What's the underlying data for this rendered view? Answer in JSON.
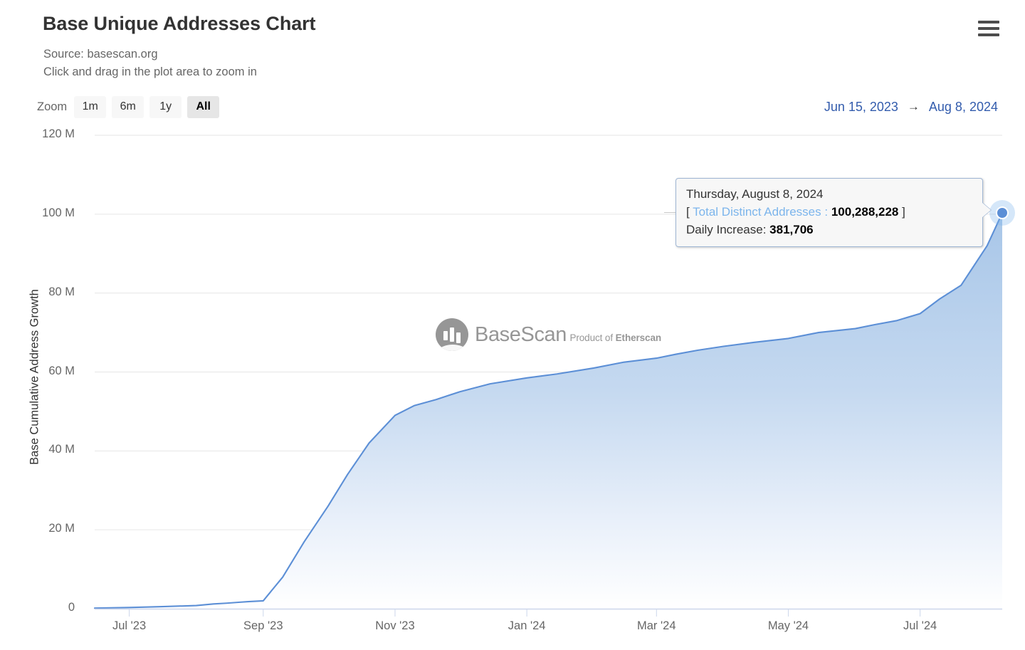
{
  "header": {
    "title": "Base Unique Addresses Chart",
    "source_line": "Source: basescan.org",
    "hint_line": "Click and drag in the plot area to zoom in",
    "menu_icon": "hamburger-menu-icon"
  },
  "range_selector": {
    "zoom_label": "Zoom",
    "buttons": [
      {
        "label": "1m",
        "selected": false
      },
      {
        "label": "6m",
        "selected": false
      },
      {
        "label": "1y",
        "selected": false
      },
      {
        "label": "All",
        "selected": true
      }
    ],
    "date_from": "Jun 15, 2023",
    "date_arrow": "→",
    "date_to": "Aug 8, 2024",
    "link_color": "#335cad"
  },
  "tooltip": {
    "date": "Thursday, August 8, 2024",
    "open_bracket": "[",
    "series_name": "Total Distinct Addresses",
    "colon": ":",
    "series_value": "100,288,228",
    "close_bracket": "]",
    "secondary_label": "Daily Increase:",
    "secondary_value": "381,706",
    "series_color": "#7cb5ec"
  },
  "watermark": {
    "main": "BaseScan",
    "sub_prefix": "Product of ",
    "sub_bold": "Etherscan"
  },
  "chart_data": {
    "type": "area",
    "title": "Base Unique Addresses Chart",
    "subtitle": "Source: basescan.org",
    "xlabel": "",
    "ylabel": "Base Cumulative Address Growth",
    "ylim": [
      0,
      120000000
    ],
    "y_ticks": [
      0,
      20000000,
      40000000,
      60000000,
      80000000,
      100000000,
      120000000
    ],
    "y_tick_labels": [
      "0",
      "20 M",
      "40 M",
      "60 M",
      "80 M",
      "100 M",
      "120 M"
    ],
    "x_tick_labels": [
      "Jul '23",
      "Sep '23",
      "Nov '23",
      "Jan '24",
      "Mar '24",
      "May '24",
      "Jul '24"
    ],
    "x_range": [
      "Jun 15, 2023",
      "Aug 8, 2024"
    ],
    "grid": true,
    "legend_position": "none",
    "line_color": "#5c8fd6",
    "fill_top_color": "#a8c6e8",
    "fill_bottom_color": "#ffffff",
    "series": [
      {
        "name": "Total Distinct Addresses",
        "x": [
          "2023-06-15",
          "2023-07-01",
          "2023-07-15",
          "2023-08-01",
          "2023-08-09",
          "2023-08-15",
          "2023-08-20",
          "2023-08-25",
          "2023-09-01",
          "2023-09-10",
          "2023-09-20",
          "2023-10-01",
          "2023-10-10",
          "2023-10-20",
          "2023-11-01",
          "2023-11-10",
          "2023-11-20",
          "2023-12-01",
          "2023-12-15",
          "2024-01-01",
          "2024-01-15",
          "2024-02-01",
          "2024-02-15",
          "2024-03-01",
          "2024-03-10",
          "2024-03-20",
          "2024-04-01",
          "2024-04-15",
          "2024-05-01",
          "2024-05-15",
          "2024-06-01",
          "2024-06-10",
          "2024-06-20",
          "2024-07-01",
          "2024-07-10",
          "2024-07-20",
          "2024-08-01",
          "2024-08-08"
        ],
        "values": [
          150000,
          300000,
          500000,
          800000,
          1200000,
          1400000,
          1600000,
          1800000,
          2000000,
          8000000,
          17000000,
          26000000,
          34000000,
          42000000,
          49000000,
          51500000,
          53000000,
          55000000,
          57000000,
          58500000,
          59500000,
          61000000,
          62500000,
          63500000,
          64500000,
          65500000,
          66500000,
          67500000,
          68500000,
          70000000,
          71000000,
          72000000,
          73000000,
          74800000,
          78500000,
          82000000,
          92000000,
          100288228
        ]
      }
    ],
    "highlight_point": {
      "date": "2024-08-08",
      "value": 100288228,
      "daily_increase": 381706
    }
  }
}
